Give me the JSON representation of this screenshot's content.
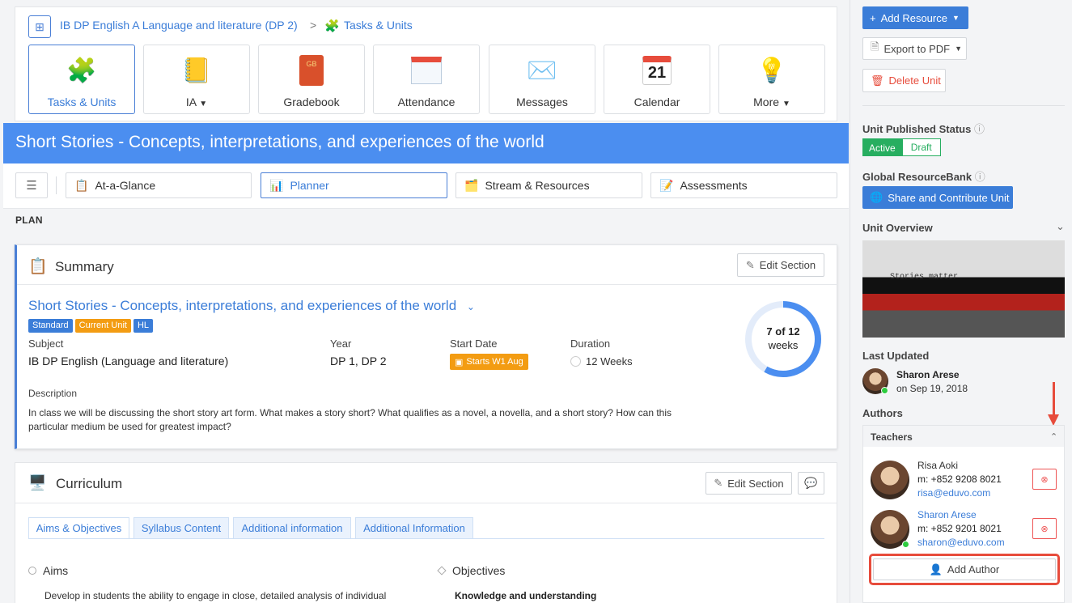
{
  "breadcrumb": {
    "course": "IB DP English A Language and literature (DP 2)",
    "separator": ">",
    "current": "Tasks & Units"
  },
  "nav_tiles": [
    {
      "label": "Tasks & Units",
      "icon": "puzzle-icon"
    },
    {
      "label": "IA",
      "icon": "notebook-icon",
      "dropdown": true
    },
    {
      "label": "Gradebook",
      "icon": "gradebook-icon"
    },
    {
      "label": "Attendance",
      "icon": "attendance-calendar-icon"
    },
    {
      "label": "Messages",
      "icon": "envelope-icon"
    },
    {
      "label": "Calendar",
      "icon": "calendar-icon",
      "day": "21"
    },
    {
      "label": "More",
      "icon": "lightbulb-chat-icon",
      "dropdown": true
    }
  ],
  "unit_title": "Short Stories - Concepts, interpretations, and experiences of the world",
  "sub_tabs": [
    {
      "label": "At-a-Glance"
    },
    {
      "label": "Planner"
    },
    {
      "label": "Stream & Resources"
    },
    {
      "label": "Assessments"
    }
  ],
  "plan_label": "PLAN",
  "summary": {
    "heading": "Summary",
    "edit_label": "Edit Section",
    "unit_link": "Short Stories - Concepts, interpretations, and experiences of the world",
    "badges": [
      {
        "label": "Standard",
        "color": "#3b7dd8"
      },
      {
        "label": "Current Unit",
        "color": "#f39c12"
      },
      {
        "label": "HL",
        "color": "#3b7dd8"
      }
    ],
    "subject_label": "Subject",
    "subject_value": "IB DP English (Language and literature)",
    "year_label": "Year",
    "year_value": "DP 1, DP 2",
    "start_label": "Start Date",
    "start_value": "Starts W1 Aug",
    "duration_label": "Duration",
    "duration_value": "12 Weeks",
    "progress_text": "7 of 12",
    "progress_unit": "weeks",
    "progress_fraction": 0.583,
    "description_label": "Description",
    "description_line1": "In class we will be discussing the short story art form. What makes a story short? What qualifies as a novel, a novella, and a short story? How can this",
    "description_line2": "particular medium be used for greatest impact?"
  },
  "curriculum": {
    "heading": "Curriculum",
    "edit_label": "Edit Section",
    "tabs": [
      "Aims & Objectives",
      "Syllabus Content",
      "Additional information",
      "Additional Information"
    ],
    "aims_label": "Aims",
    "aims_text": "Develop in students the ability to engage in close, detailed analysis of individual",
    "objectives_label": "Objectives",
    "objectives_sub": "Knowledge and understanding"
  },
  "sidebar": {
    "add_resource": "Add Resource",
    "export_pdf": "Export to PDF",
    "delete_unit": "Delete Unit",
    "published_label": "Unit Published Status",
    "status_active": "Active",
    "status_draft": "Draft",
    "resourcebank_label": "Global ResourceBank",
    "share_label": "Share and Contribute Unit",
    "overview_label": "Unit Overview",
    "overview_image_text": "Stories matter",
    "last_updated_label": "Last Updated",
    "updated_name": "Sharon Arese",
    "updated_date": "on Sep 19, 2018",
    "authors_label": "Authors",
    "teachers_label": "Teachers",
    "teachers": [
      {
        "name": "Risa Aoki",
        "phone": "m: +852 9208 8021",
        "email": "risa@eduvo.com"
      },
      {
        "name": "Sharon Arese",
        "phone": "m: +852 9201 8021",
        "email": "sharon@eduvo.com"
      }
    ],
    "add_author": "Add Author"
  }
}
